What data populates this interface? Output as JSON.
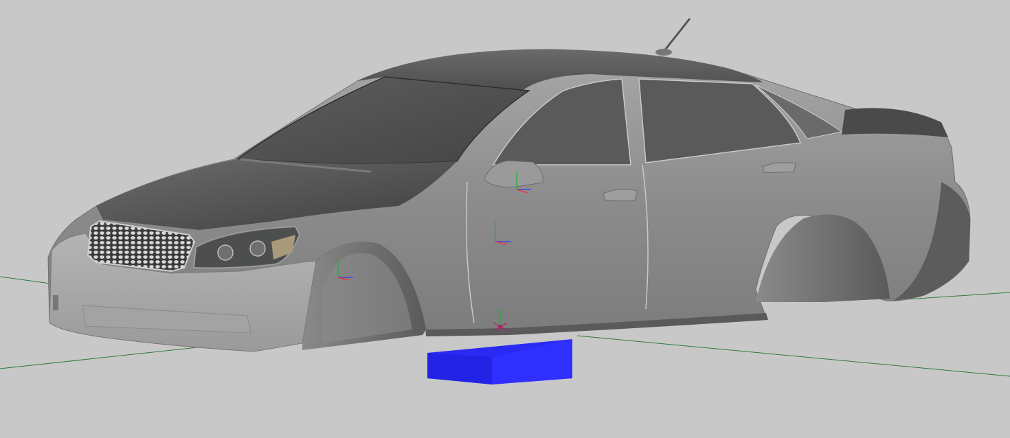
{
  "viewport": {
    "background_color": "#c8c8c8",
    "grid_line_color": "#2f7a3a",
    "scene": {
      "object": "sedan-body-shell-without-wheels",
      "body_color": "#8f8f8f",
      "glass_color": "#4a4a4a",
      "support_block_color": "#2323f2",
      "wheels_present": false
    },
    "gizmos": {
      "axis_colors": {
        "x": "#ff2d2d",
        "y": "#1fae3a",
        "z": "#2a3dff"
      },
      "pivot_marker_color": "#b0206a",
      "count": 4
    }
  }
}
